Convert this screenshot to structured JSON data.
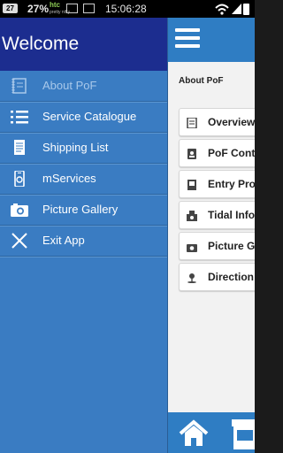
{
  "status_bar": {
    "notification_badge": "27",
    "battery_percent": "27%",
    "carrier": "htc",
    "carrier_sub": "pretty nifty",
    "time": "15:06:28"
  },
  "drawer": {
    "title": "Welcome",
    "items": [
      {
        "label": "About PoF",
        "icon": "about-book-icon",
        "enabled": false
      },
      {
        "label": "Service Catalogue",
        "icon": "list-icon",
        "enabled": true
      },
      {
        "label": "Shipping List",
        "icon": "document-icon",
        "enabled": true
      },
      {
        "label": "mServices",
        "icon": "mobile-phone-icon",
        "enabled": true
      },
      {
        "label": "Picture Gallery",
        "icon": "camera-icon",
        "enabled": true
      },
      {
        "label": "Exit App",
        "icon": "close-icon",
        "enabled": true
      }
    ]
  },
  "main": {
    "section_title": "About PoF",
    "cards": [
      {
        "label": "Overview",
        "icon": "book-icon"
      },
      {
        "label": "PoF Cont",
        "icon": "contact-icon"
      },
      {
        "label": "Entry Pro",
        "icon": "entry-icon"
      },
      {
        "label": "Tidal Info",
        "icon": "tide-icon"
      },
      {
        "label": "Picture G",
        "icon": "camera-icon"
      },
      {
        "label": "Direction",
        "icon": "location-icon"
      }
    ]
  },
  "colors": {
    "drawer_bg": "#3a7cc2",
    "drawer_header": "#1c2d8f",
    "appbar": "#2f7dc3",
    "content_bg": "#f2f2f2"
  }
}
